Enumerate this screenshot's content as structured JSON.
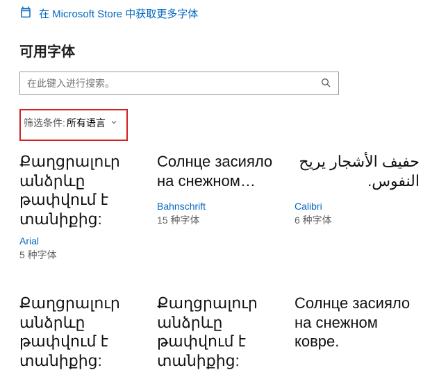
{
  "store_link": {
    "text": "在 Microsoft Store 中获取更多字体"
  },
  "section_title": "可用字体",
  "search": {
    "placeholder": "在此键入进行搜索。"
  },
  "filter": {
    "label": "筛选条件:",
    "value": "所有语言"
  },
  "colors": {
    "accent": "#0067c0",
    "highlight_border": "#d42020"
  },
  "fonts": [
    {
      "sample": "Քաղցրալուր անձրևը թափվում է տանիքից:",
      "name": "Arial",
      "count": "5 种字体",
      "rtl": false
    },
    {
      "sample": "Солнце засияло на снежном…",
      "name": "Bahnschrift",
      "count": "15 种字体",
      "rtl": false
    },
    {
      "sample": "حفيف الأشجار يريح النفوس.",
      "name": "Calibri",
      "count": "6 种字体",
      "rtl": true
    },
    {
      "sample": "Քաղցրալուր անձրևը թափվում է տանիքից:",
      "name": "",
      "count": "",
      "rtl": false
    },
    {
      "sample": "Քաղցրալուր անձրևը թափվում է տանիքից:",
      "name": "",
      "count": "",
      "rtl": false
    },
    {
      "sample": "Солнце засияло на снежном ковре.",
      "name": "",
      "count": "",
      "rtl": false
    }
  ]
}
